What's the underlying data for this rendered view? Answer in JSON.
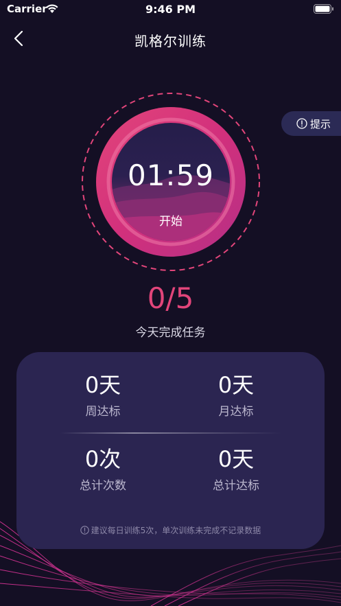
{
  "status_bar": {
    "carrier": "Carrier",
    "time": "9:46 PM"
  },
  "nav": {
    "title": "凯格尔训练"
  },
  "hint_button": {
    "label": "提示"
  },
  "timer": {
    "time": "01:59",
    "start_label": "开始"
  },
  "progress": {
    "value": "0/5",
    "label": "今天完成任务"
  },
  "stats": [
    {
      "value": "0天",
      "label": "周达标"
    },
    {
      "value": "0天",
      "label": "月达标"
    },
    {
      "value": "0次",
      "label": "总计次数"
    },
    {
      "value": "0天",
      "label": "总计达标"
    }
  ],
  "tip": "建议每日训练5次，单次训练未完成不记录数据",
  "colors": {
    "background": "#140f24",
    "accent": "#e2457a",
    "card": "#2b2551",
    "hint_button": "#2b2a55"
  },
  "icons": [
    "wifi-icon",
    "battery-icon",
    "back-icon",
    "info-icon"
  ]
}
